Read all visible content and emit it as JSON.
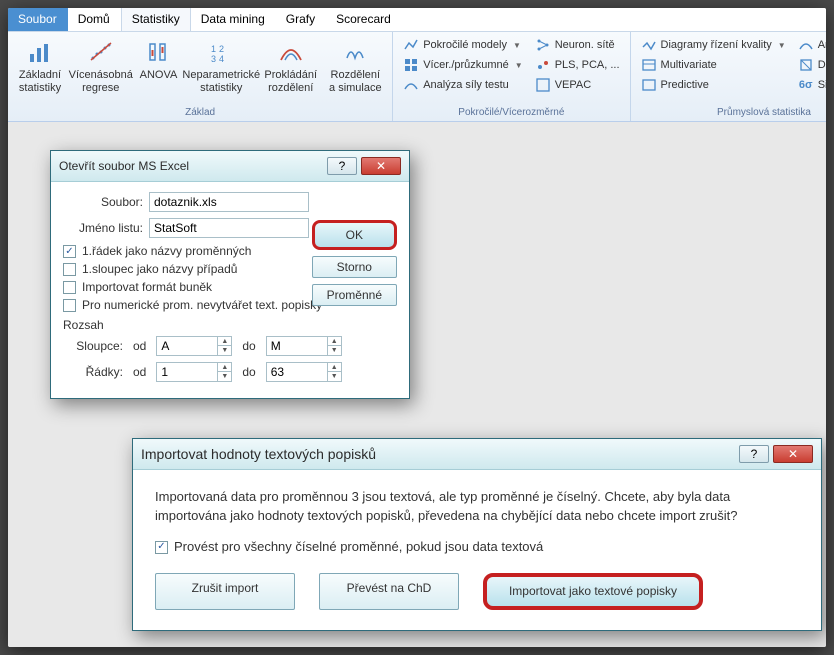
{
  "ribbon_tabs": {
    "file": "Soubor",
    "home": "Domů",
    "stats": "Statistiky",
    "datamining": "Data mining",
    "charts": "Grafy",
    "scorecard": "Scorecard"
  },
  "ribbon": {
    "group_basic": {
      "label": "Základ",
      "items": {
        "basic_stats": "Základní\nstatistiky",
        "multi_regression": "Vícenásobná\nregrese",
        "anova": "ANOVA",
        "nonparam": "Neparametrické\nstatistiky",
        "fit": "Prokládání\nrozdělení",
        "sim": "Rozdělení a\nsimulace"
      }
    },
    "group_advanced": {
      "label": "Pokročilé/Vícerozměrné",
      "items": {
        "adv_models": "Pokročilé modely",
        "multiexp": "Vícer./průzkumné",
        "power": "Analýza síly testu",
        "neural": "Neuron. sítě",
        "pls": "PLS, PCA, ...",
        "vepac": "VEPAC"
      }
    },
    "group_industrial": {
      "label": "Průmyslová statistika",
      "items": {
        "quality": "Diagramy řízení kvality",
        "multivariate": "Multivariate",
        "predictive": "Predictive",
        "process": "Analýza proce",
        "doe": "DOE",
        "sixsigma": "Six Sigma"
      }
    }
  },
  "dialog1": {
    "title": "Otevřít soubor MS Excel",
    "file_label": "Soubor:",
    "file_value": "dotaznik.xls",
    "sheet_label": "Jméno listu:",
    "sheet_value": "StatSoft",
    "ok": "OK",
    "storno": "Storno",
    "variables": "Proměnné",
    "cb_row1": "1.řádek jako názvy proměnných",
    "cb_col1": "1.sloupec jako názvy případů",
    "cb_format": "Importovat formát buněk",
    "cb_numeric": "Pro numerické prom. nevytvářet text. popisky",
    "range_label": "Rozsah",
    "cols_label": "Sloupce:",
    "rows_label": "Řádky:",
    "from": "od",
    "to": "do",
    "col_from": "A",
    "col_to": "M",
    "row_from": "1",
    "row_to": "63"
  },
  "dialog2": {
    "title": "Importovat hodnoty textových popisků",
    "text": "Importovaná data pro proměnnou 3 jsou textová, ale typ proměnné je číselný.  Chcete, aby byla data importována jako hodnoty textových popisků, převedena na chybějící data nebo chcete import zrušit?",
    "cb_all": "Provést pro všechny číselné proměnné, pokud jsou data textová",
    "btn_cancel": "Zrušit import",
    "btn_chd": "Převést na ChD",
    "btn_import": "Importovat jako textové popisky"
  }
}
